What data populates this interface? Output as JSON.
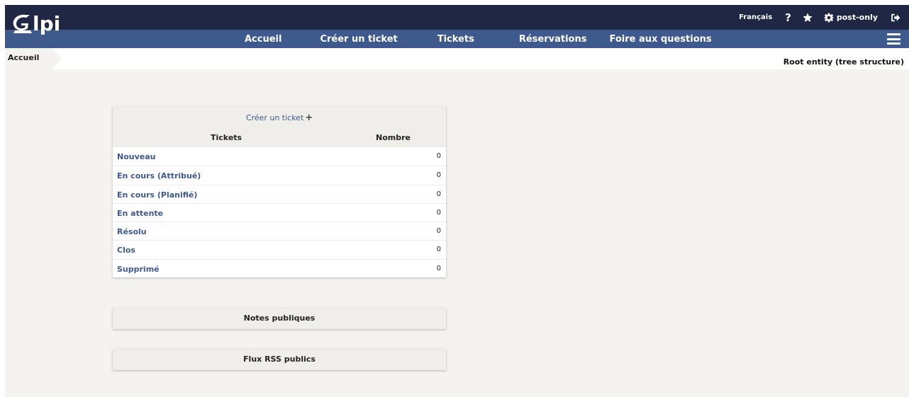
{
  "header": {
    "logo_text": "Glpi",
    "language": "Français",
    "help": "?",
    "user": "post-only"
  },
  "nav": {
    "items": [
      {
        "label": "Accueil"
      },
      {
        "label": "Créer un ticket"
      },
      {
        "label": "Tickets"
      },
      {
        "label": "Réservations"
      },
      {
        "label": "Foire aux questions"
      }
    ]
  },
  "breadcrumb": {
    "label": "Accueil"
  },
  "entity": "Root entity (tree structure)",
  "tickets_panel": {
    "create_link": "Créer un ticket",
    "col_tickets": "Tickets",
    "col_nombre": "Nombre",
    "rows": [
      {
        "label": "Nouveau",
        "count": "0"
      },
      {
        "label": "En cours (Attribué)",
        "count": "0"
      },
      {
        "label": "En cours (Planifié)",
        "count": "0"
      },
      {
        "label": "En attente",
        "count": "0"
      },
      {
        "label": "Résolu",
        "count": "0"
      },
      {
        "label": "Clos",
        "count": "0"
      },
      {
        "label": "Supprimé",
        "count": "0"
      }
    ]
  },
  "public_notes": "Notes publiques",
  "rss_feeds": "Flux RSS publics",
  "colors": {
    "header_dark": "#202744",
    "header_nav": "#3e598c",
    "link": "#3e598c",
    "background": "#f4f3ef"
  }
}
